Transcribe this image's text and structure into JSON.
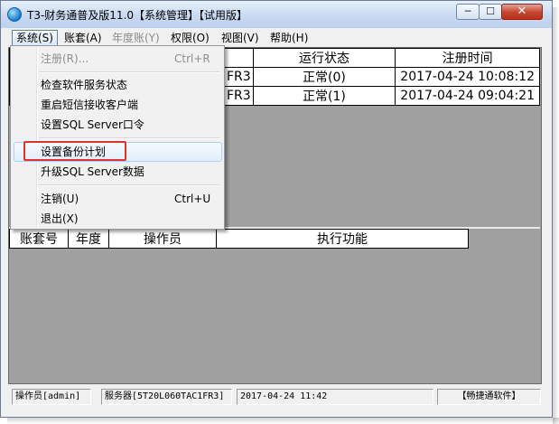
{
  "window": {
    "title": "T3-财务通普及版11.0【系统管理】【试用版】",
    "min_glyph": "─",
    "max_glyph": "☐",
    "close_glyph": "✕"
  },
  "menubar": {
    "items": [
      {
        "label": "系统(S)",
        "state": "active"
      },
      {
        "label": "账套(A)",
        "state": "normal"
      },
      {
        "label": "年度账(Y)",
        "state": "disabled"
      },
      {
        "label": "权限(O)",
        "state": "normal"
      },
      {
        "label": "视图(V)",
        "state": "normal"
      },
      {
        "label": "帮助(H)",
        "state": "normal"
      }
    ]
  },
  "system_menu": {
    "items": [
      {
        "label": "注册(R)...",
        "shortcut": "Ctrl+R",
        "disabled": true
      },
      {
        "label": "检查软件服务状态",
        "shortcut": ""
      },
      {
        "label": "重启短信接收客户端",
        "shortcut": ""
      },
      {
        "label": "设置SQL Server口令",
        "shortcut": ""
      },
      {
        "label": "设置备份计划",
        "shortcut": "",
        "highlighted": true
      },
      {
        "label": "升级SQL Server数据",
        "shortcut": ""
      },
      {
        "label": "注销(U)",
        "shortcut": "Ctrl+U"
      },
      {
        "label": "退出(X)",
        "shortcut": ""
      }
    ],
    "highlight_color": "#e0322d"
  },
  "sites_table": {
    "headers": [
      "",
      "运行状态",
      "注册时间"
    ],
    "rows": [
      {
        "server": "FR3",
        "status": "正常(0)",
        "time": "2017-04-24 10:08:12"
      },
      {
        "server": "FR3",
        "status": "正常(1)",
        "time": "2017-04-24 09:04:21"
      }
    ]
  },
  "tasks_table": {
    "headers": [
      "账套号",
      "年度",
      "操作员",
      "执行功能"
    ]
  },
  "statusbar": {
    "operator": "操作员[admin]",
    "server": "服务器[5T20L060TAC1FR3]",
    "datetime": "2017-04-24 11:42",
    "vendor": "【畅捷通软件】"
  },
  "colors": {
    "client_bg": "#a0a0a0",
    "menu_bg": "#f1f1f1",
    "titlebar": "#c9daf0"
  }
}
